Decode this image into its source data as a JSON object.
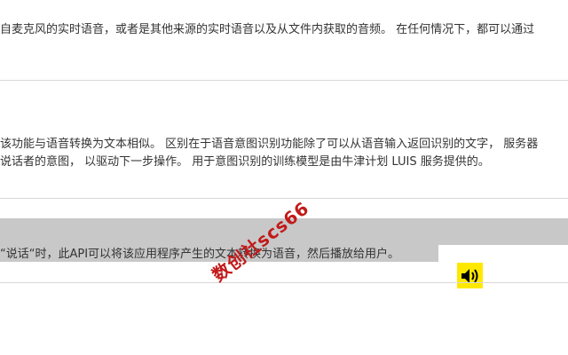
{
  "section1": {
    "line1": "自麦克风的实时语音，或者是其他来源的实时语音以及从文件内获取的音频。 在任何情况下，都可以通过"
  },
  "section2": {
    "line1": "该功能与语音转换为文本相似。 区别在于语音意图识别功能除了可以从语音输入返回识别的文字， 服务器",
    "line2": "说话者的意图， 以驱动下一步操作。 用于意图识别的训练模型是由牛津计划 LUIS 服务提供的。"
  },
  "section3": {
    "line1": "“说话“时，此API可以将该应用程序产生的文本转换为语音，然后播放给用户。",
    "speaker_icon": "speaker-volume-icon",
    "speaker_color": "#ffe800"
  },
  "watermark": "数创社scs66"
}
